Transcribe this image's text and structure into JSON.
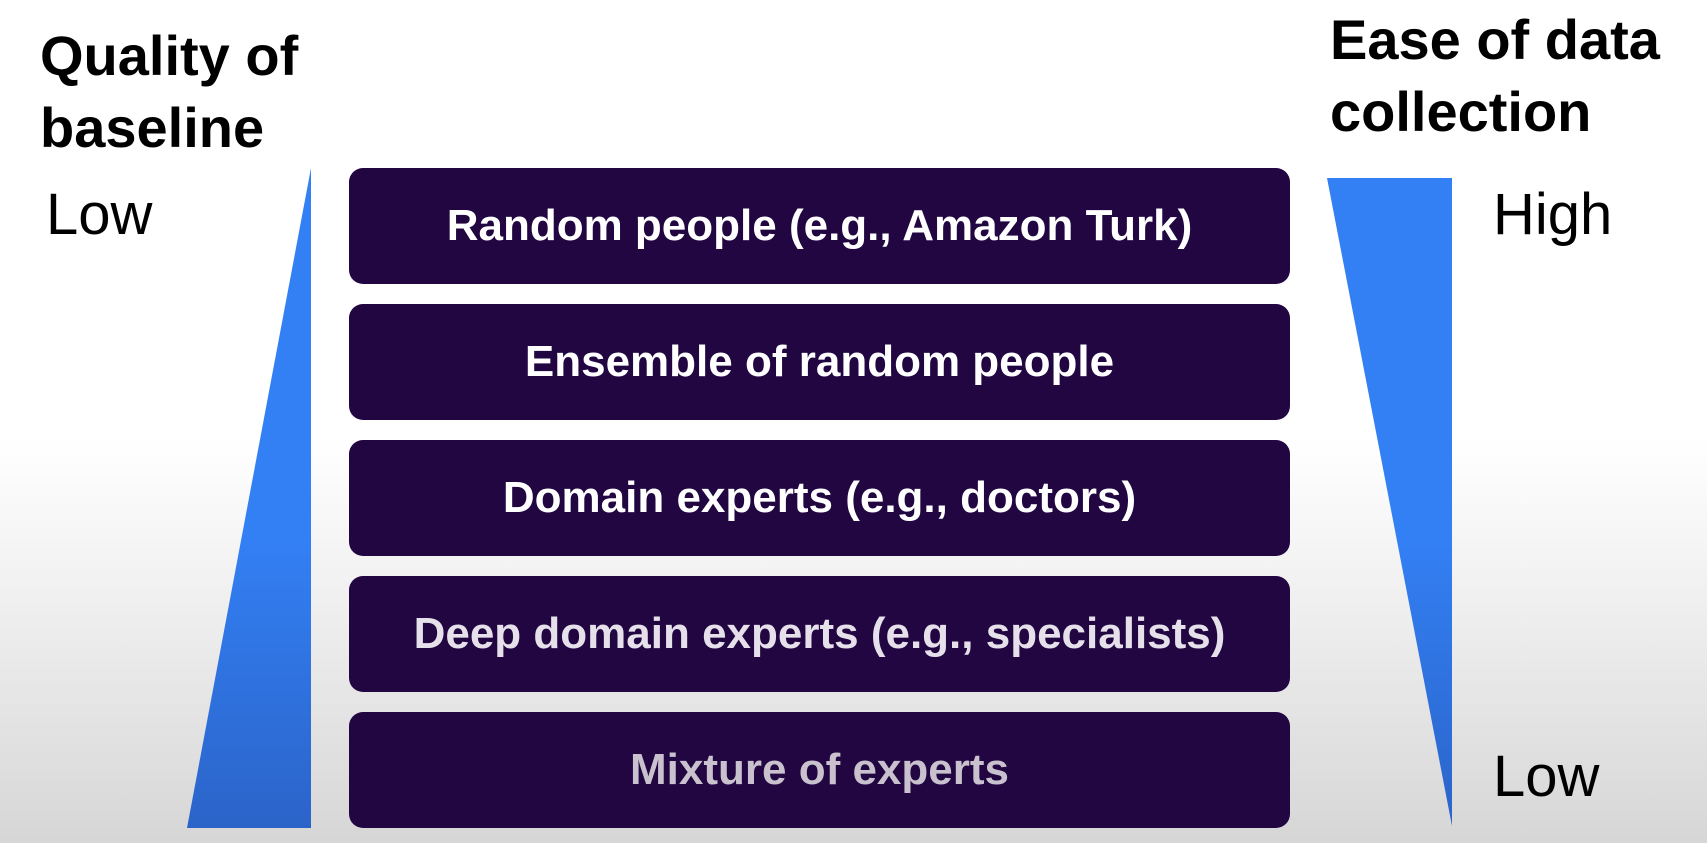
{
  "left_axis": {
    "title_lines": [
      "Quality of",
      "baseline"
    ],
    "top_label": "Low"
  },
  "right_axis": {
    "title_lines": [
      "Ease of data",
      "collection"
    ],
    "top_label": "High",
    "bottom_label": "Low"
  },
  "levels": [
    {
      "label": "Random people (e.g., Amazon Turk)",
      "text_color": "#ffffff"
    },
    {
      "label": "Ensemble of random people",
      "text_color": "#ffffff"
    },
    {
      "label": "Domain experts (e.g., doctors)",
      "text_color": "#ffffff"
    },
    {
      "label": "Deep domain experts (e.g., specialists)",
      "text_color": "#e6e0ea"
    },
    {
      "label": "Mixture of experts",
      "text_color": "#c9c2ce"
    }
  ],
  "colors": {
    "box_fill": "#210642",
    "wedge_fill": "#3380f5",
    "wedge_fill_dark": "#2b64c9"
  }
}
